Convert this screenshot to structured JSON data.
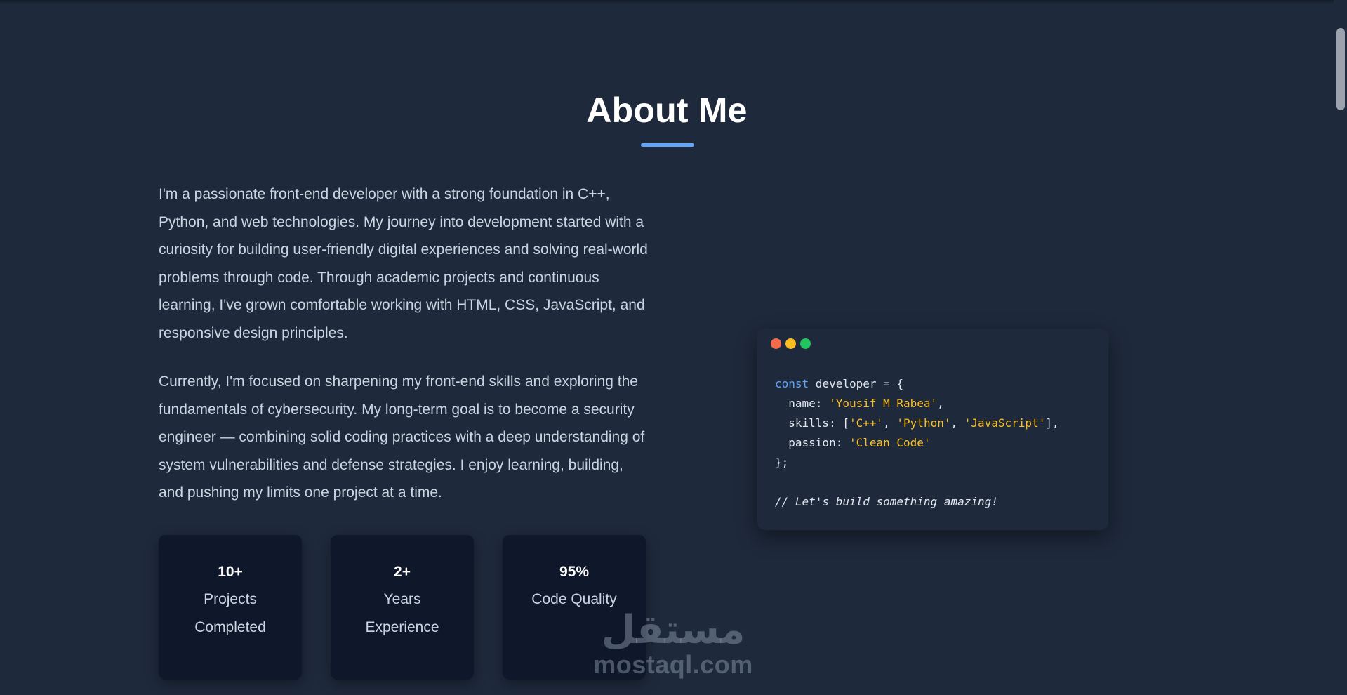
{
  "section": {
    "title": "About Me",
    "accent_color": "#60a5fa"
  },
  "bio": {
    "paragraph_1": "I'm a passionate front-end developer with a strong foundation in C++, Python, and web technologies. My journey into development started with a curiosity for building user-friendly digital experiences and solving real-world problems through code. Through academic projects and continuous learning, I've grown comfortable working with HTML, CSS, JavaScript, and responsive design principles.",
    "paragraph_2": "Currently, I'm focused on sharpening my front-end skills and exploring the fundamentals of cybersecurity. My long-term goal is to become a security engineer — combining solid coding practices with a deep understanding of system vulnerabilities and defense strategies. I enjoy learning, building, and pushing my limits one project at a time."
  },
  "stats": [
    {
      "value": "10+",
      "label": "Projects Completed"
    },
    {
      "value": "2+",
      "label": "Years Experience"
    },
    {
      "value": "95%",
      "label": "Code Quality"
    }
  ],
  "code_window": {
    "dots": [
      "#f26b4b",
      "#fbbf24",
      "#22c55e"
    ],
    "keyword": "const",
    "variable": " developer = {",
    "name_key": "  name: ",
    "name_value": "'Yousif M Rabea'",
    "skills_key": "  skills: [",
    "skill_1": "'C++'",
    "skill_2": "'Python'",
    "skill_3": "'JavaScript'",
    "passion_key": "  passion: ",
    "passion_value": "'Clean Code'",
    "close": "};",
    "comment": "// Let's build something amazing!"
  },
  "watermark": {
    "arabic": "مستقل",
    "latin": "mostaql.com"
  },
  "scrollbar": {
    "position_fraction": 0.04
  }
}
